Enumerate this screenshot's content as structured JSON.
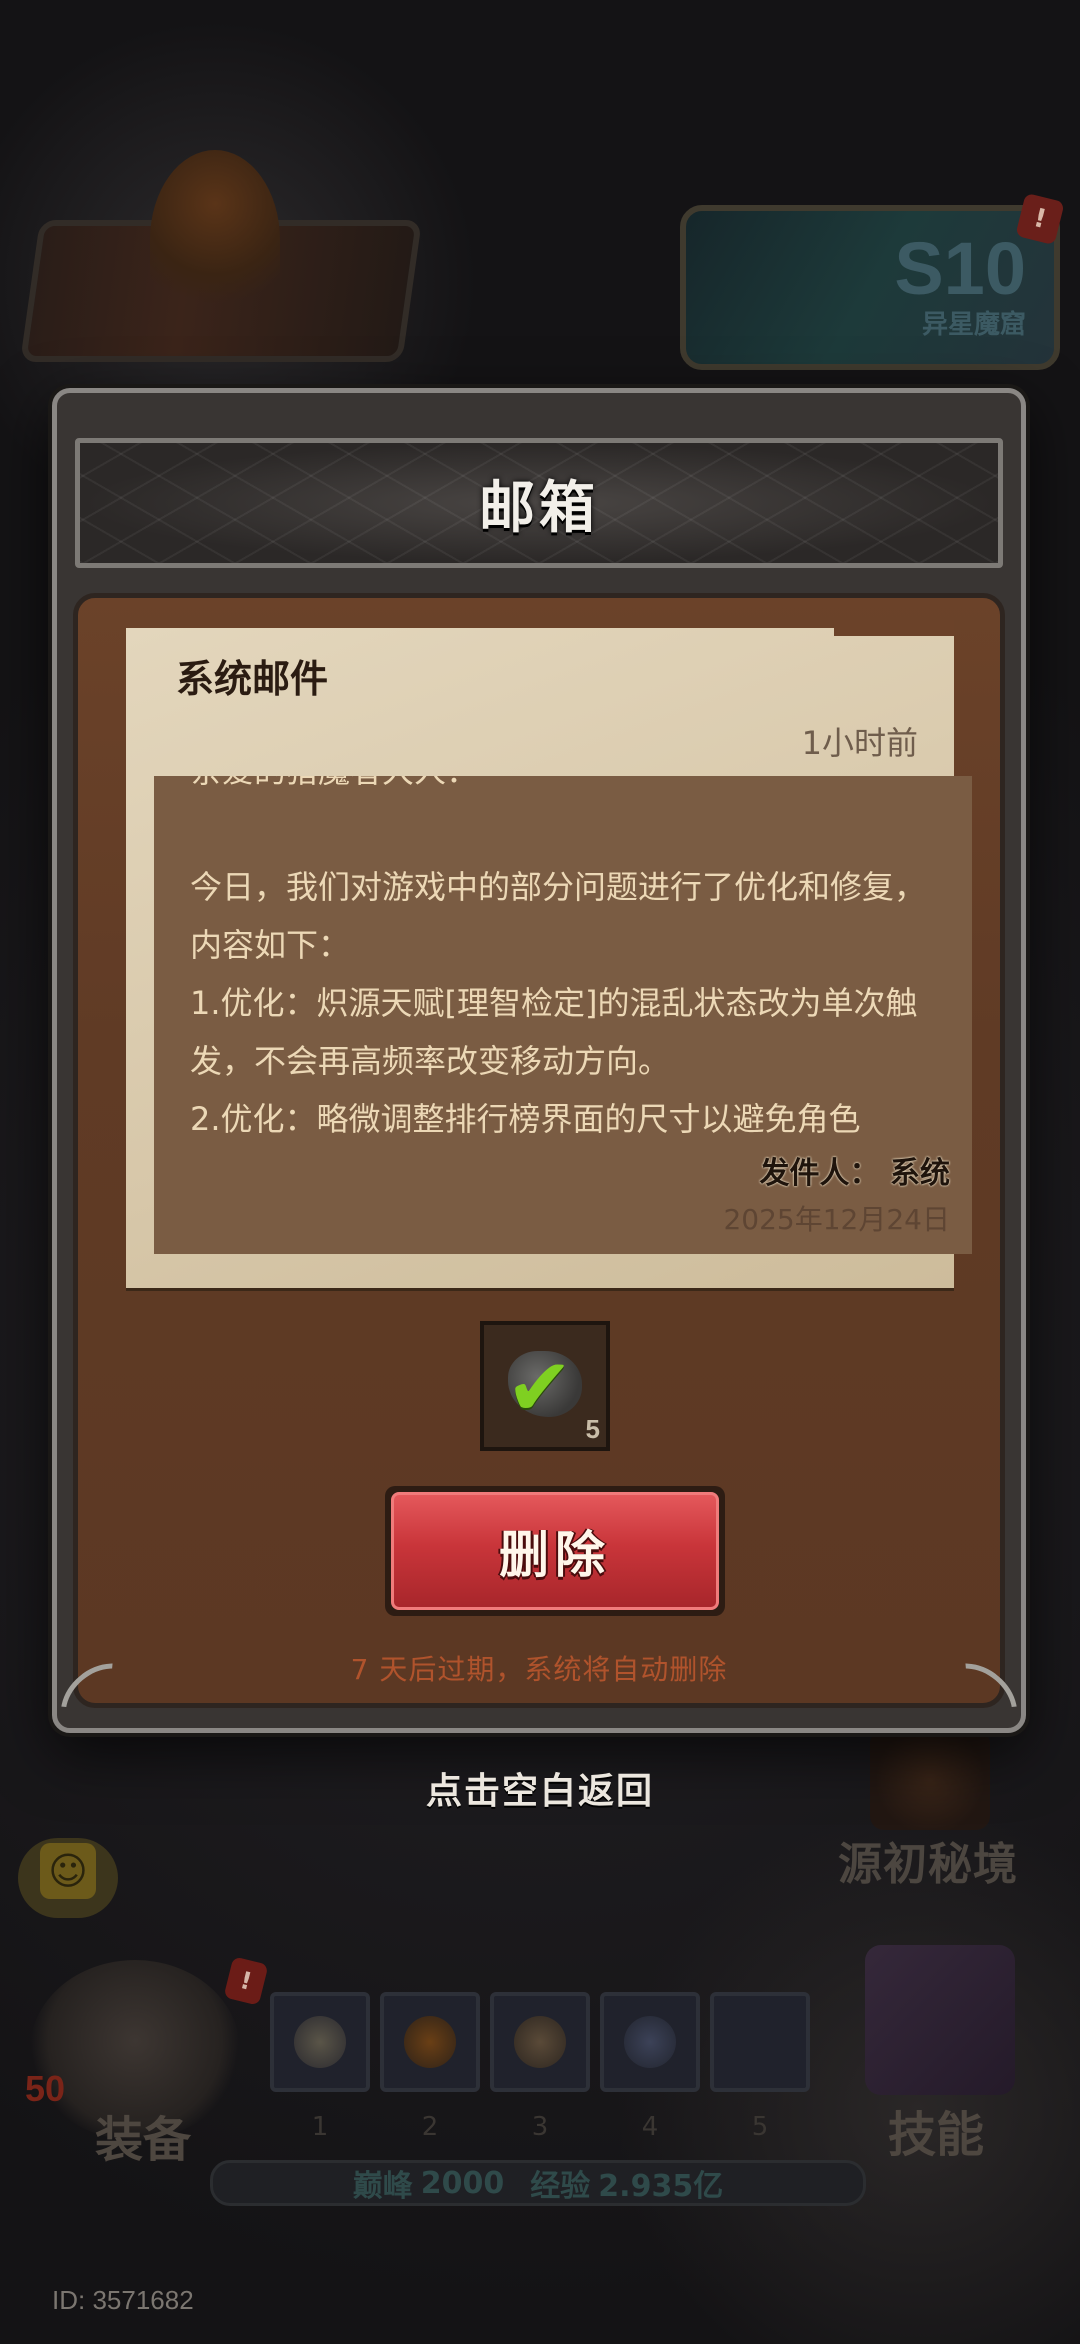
{
  "background": {
    "event_card": {
      "title": "S10",
      "subtitle": "异星魔窟",
      "alert": "!"
    },
    "realm_label": "源初秘境",
    "hero": {
      "level": "50",
      "alert": "!",
      "equip_label": "装备"
    },
    "skills": {
      "label": "技能",
      "slots": [
        "1",
        "2",
        "3",
        "4",
        "5"
      ]
    },
    "exp_bar": {
      "peak_label": "巅峰",
      "peak_value": "2000",
      "exp_label": "经验",
      "exp_value": "2.935亿"
    },
    "player_id": "ID: 3571682"
  },
  "mailbox": {
    "title": "邮箱",
    "mail": {
      "from_label": "系统邮件",
      "time_ago": "1小时前",
      "body": "亲爱的猎魔者大人：\n\n今日，我们对游戏中的部分问题进行了优化和修复，内容如下：\n1.优化：炽源天赋[理智检定]的混乱状态改为单次触发，不会再高频率改变移动方向。\n2.优化：略微调整排行榜界面的尺寸以避免角色",
      "sender_label": "发件人：",
      "sender": "系统",
      "date": "2025年12月24日"
    },
    "attachment": {
      "icon": "ore-icon",
      "claimed": true,
      "count": "5"
    },
    "delete_label": "删除",
    "expire_note": "7 天后过期，系统将自动删除"
  },
  "tap_return": "点击空白返回",
  "colors": {
    "delete_red": "#c9353a",
    "claimed_check": "#7fd021",
    "expire_note": "#b0532c"
  }
}
